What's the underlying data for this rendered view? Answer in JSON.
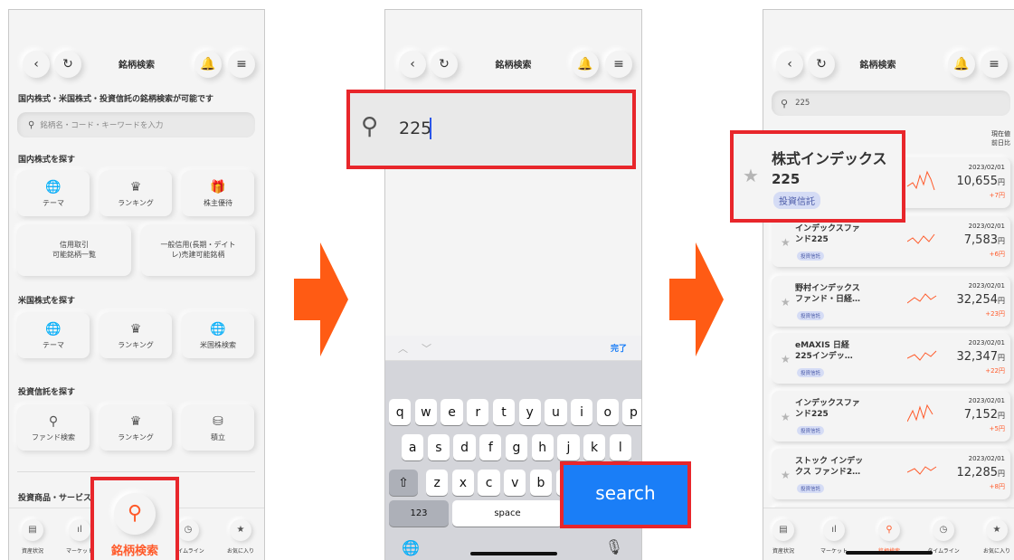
{
  "colors": {
    "accent": "#ff5a2a",
    "highlight": "#e8262b",
    "arrow": "#ff5b14",
    "search_key": "#1a7ef7",
    "badge_bg": "#d5dcf5"
  },
  "phone1": {
    "title": "銘柄検索",
    "heading": "国内株式・米国株式・投資信託の銘柄検索が可能です",
    "search_placeholder": "銘柄名・コード・キーワードを入力",
    "domestic": {
      "title": "国内株式を探す",
      "items": [
        "テーマ",
        "ランキング",
        "株主優待"
      ],
      "wide_items": [
        "信用取引\n可能銘柄一覧",
        "一般信用(長期・デイト\nレ)売建可能銘柄"
      ]
    },
    "us": {
      "title": "米国株式を探す",
      "items": [
        "テーマ",
        "ランキング",
        "米国株検索"
      ]
    },
    "funds": {
      "title": "投資信託を探す",
      "items": [
        "ファンド検索",
        "ランキング",
        "積立"
      ]
    },
    "products_title": "投資商品・サービス",
    "tabs": [
      "資産状況",
      "マーケット",
      "銘柄検索",
      "タイムライン",
      "お気に入り"
    ],
    "highlight_label": "銘柄検索"
  },
  "phone2": {
    "title": "銘柄検索",
    "query": "225",
    "done_label": "完了",
    "rows": [
      [
        "q",
        "w",
        "e",
        "r",
        "t",
        "y",
        "u",
        "i",
        "o",
        "p"
      ],
      [
        "a",
        "s",
        "d",
        "f",
        "g",
        "h",
        "j",
        "k",
        "l"
      ],
      [
        "z",
        "x",
        "c",
        "v",
        "b",
        "n",
        "m"
      ]
    ],
    "num_key": "123",
    "space_key": "space",
    "search_label": "search"
  },
  "phone3": {
    "title": "銘柄検索",
    "query": "225",
    "col_header": [
      "現在値",
      "前日比"
    ],
    "highlight": {
      "name_line1": "株式インデックス",
      "name_line2": "225",
      "badge": "投資信託"
    },
    "items": [
      {
        "name": "株式インデックス\n225",
        "date": "2023/02/01",
        "price": "10,655",
        "unit": "円",
        "change": "+7円",
        "badge": "投資信託"
      },
      {
        "name": "インデックスファ\nンド225",
        "date": "2023/02/01",
        "price": "7,583",
        "unit": "円",
        "change": "+6円",
        "badge": "投資信託"
      },
      {
        "name": "野村インデックス\nファンド・日経…",
        "date": "2023/02/01",
        "price": "32,254",
        "unit": "円",
        "change": "+23円",
        "badge": "投資信託"
      },
      {
        "name": "eMAXIS 日経\n225インデッ…",
        "date": "2023/02/01",
        "price": "32,347",
        "unit": "円",
        "change": "+22円",
        "badge": "投資信託"
      },
      {
        "name": "インデックスファ\nンド225",
        "date": "2023/02/01",
        "price": "7,152",
        "unit": "円",
        "change": "+5円",
        "badge": "投資信託"
      },
      {
        "name": "ストック インデッ\nクス ファンド2…",
        "date": "2023/02/01",
        "price": "12,285",
        "unit": "円",
        "change": "+8円",
        "badge": "投資信託"
      }
    ],
    "partial_date": "2023/02/01",
    "tabs": [
      "資産状況",
      "マーケット",
      "銘柄検索",
      "タイムライン",
      "お気に入り"
    ]
  }
}
